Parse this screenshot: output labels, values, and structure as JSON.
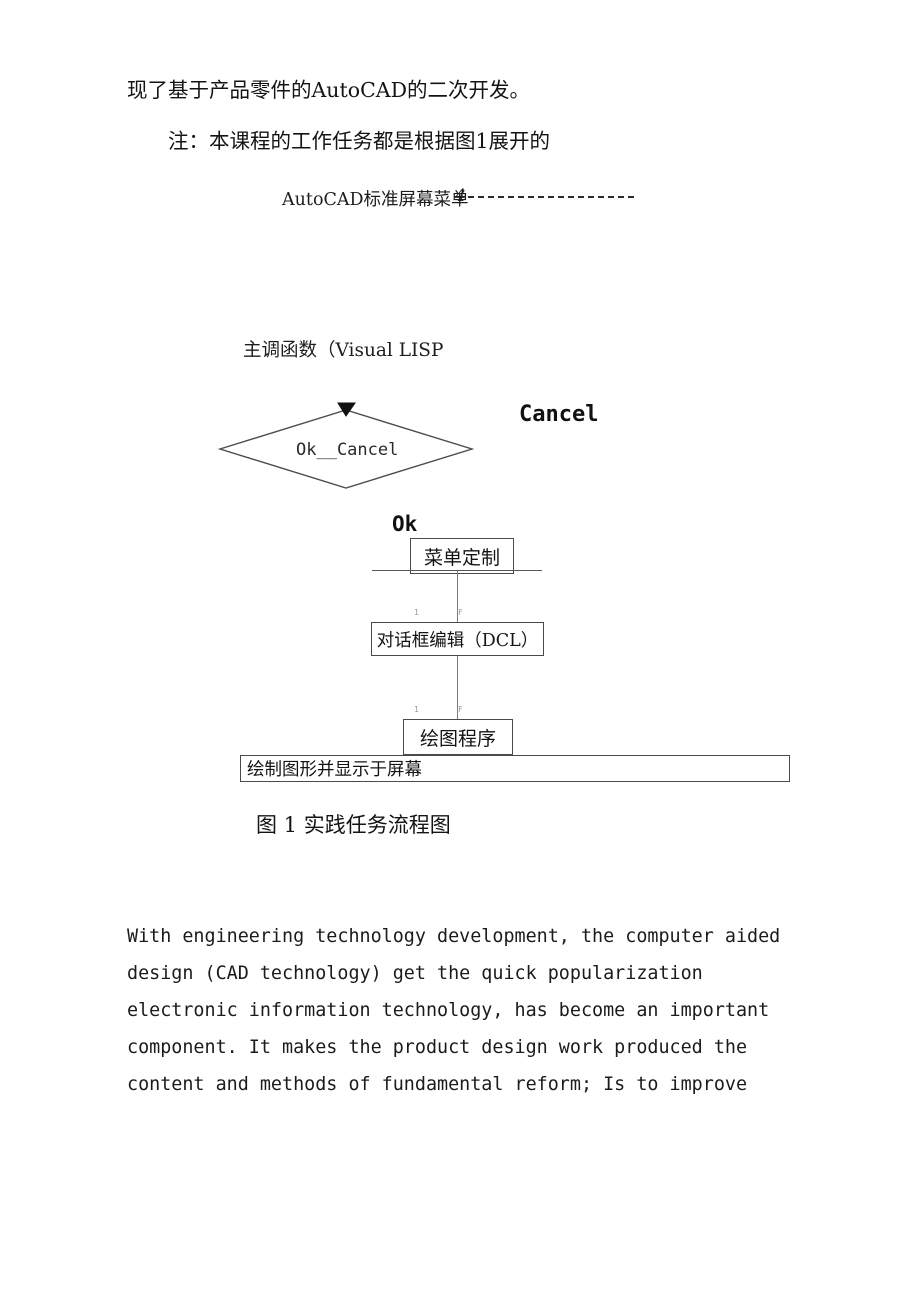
{
  "document": {
    "intro_line": "现了基于产品零件的AutoCAD的二次开发。",
    "note_line": "注：本课程的工作任务都是根据图1展开的"
  },
  "diagram": {
    "menu_header": "AutoCAD标准屏幕菜单",
    "menu_header_arrow": "4",
    "main_function": "主调函数（Visual LISP",
    "decision_label": "Ok__Cancel",
    "branch_cancel": "Cancel",
    "branch_ok": "Ok",
    "node_menu_custom": "菜单定制",
    "node_dialog_edit": "对话框编辑（DCL）",
    "node_draw_program": "绘图程序",
    "node_render_screen": "绘制图形并显示于屏幕",
    "tick_one": "1",
    "tick_f": "F",
    "caption": "图 1 实践任务流程图"
  },
  "english_paragraph": {
    "lines": [
      "With engineering technology development, the computer aided",
      "design (CAD technology) get the quick popularization",
      "electronic information technology, has become an important",
      "component. It makes the product design work produced the",
      "content and methods of fundamental reform; Is to improve"
    ]
  },
  "colors": {
    "text": "#141414",
    "line": "#585858",
    "connector": "#7b7b7b",
    "page_background": "#ffffff"
  }
}
